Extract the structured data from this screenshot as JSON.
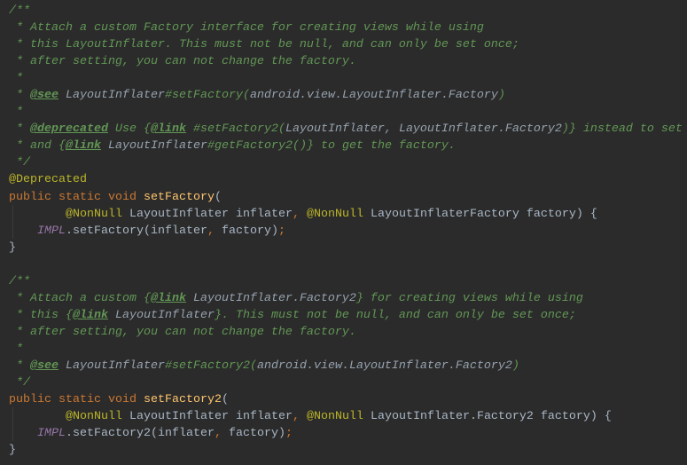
{
  "colors": {
    "background": "#2b2b2b",
    "comment": "#629755",
    "keyword": "#cc7832",
    "method": "#ffc66d",
    "annotation": "#bbb529",
    "field": "#9876aa",
    "text": "#a9b7c6"
  },
  "lines": [
    [
      [
        "/**",
        "c"
      ]
    ],
    [
      [
        " * Attach a custom Factory interface for creating views while using",
        "c"
      ]
    ],
    [
      [
        " * this LayoutInflater. This must not be null, and can only be set once;",
        "c"
      ]
    ],
    [
      [
        " * after setting, you can not change the factory.",
        "c"
      ]
    ],
    [
      [
        " *",
        "c"
      ]
    ],
    [
      [
        " * ",
        "c"
      ],
      [
        "@see",
        "tag"
      ],
      [
        " LayoutInflater",
        "ref"
      ],
      [
        "#setFactory(",
        "c"
      ],
      [
        "android.view.LayoutInflater.Factory",
        "ref"
      ],
      [
        ")",
        "c"
      ]
    ],
    [
      [
        " *",
        "c"
      ]
    ],
    [
      [
        " * ",
        "c"
      ],
      [
        "@deprecated",
        "tag"
      ],
      [
        " Use {",
        "c"
      ],
      [
        "@link",
        "tag"
      ],
      [
        " #setFactory2(",
        "c"
      ],
      [
        "LayoutInflater, LayoutInflater.Factory2",
        "ref"
      ],
      [
        ")} instead to set",
        "c"
      ]
    ],
    [
      [
        " * and {",
        "c"
      ],
      [
        "@link",
        "tag"
      ],
      [
        " LayoutInflater",
        "ref"
      ],
      [
        "#getFactory2()} to get the factory.",
        "c"
      ]
    ],
    [
      [
        " */",
        "c"
      ]
    ],
    [
      [
        "@Deprecated",
        "ann"
      ]
    ],
    [
      [
        "public static void ",
        "kw"
      ],
      [
        "setFactory",
        "fn"
      ],
      [
        "(",
        "t"
      ]
    ],
    [
      [
        "        ",
        "t"
      ],
      [
        "@NonNull",
        "ann"
      ],
      [
        " LayoutInflater inflater",
        "t"
      ],
      [
        ", ",
        "kw"
      ],
      [
        "@NonNull",
        "ann"
      ],
      [
        " LayoutInflaterFactory factory) {",
        "t"
      ]
    ],
    [
      [
        "    ",
        "t"
      ],
      [
        "IMPL",
        "fld"
      ],
      [
        ".setFactory(inflater",
        "t"
      ],
      [
        ", ",
        "kw"
      ],
      [
        "factory)",
        "t"
      ],
      [
        ";",
        "kw"
      ]
    ],
    [
      [
        "}",
        "t"
      ]
    ],
    [
      [
        "",
        "t"
      ]
    ],
    [
      [
        "/**",
        "c"
      ]
    ],
    [
      [
        " * Attach a custom {",
        "c"
      ],
      [
        "@link",
        "tag"
      ],
      [
        " LayoutInflater.Factory2",
        "ref"
      ],
      [
        "} for creating views while using",
        "c"
      ]
    ],
    [
      [
        " * this {",
        "c"
      ],
      [
        "@link",
        "tag"
      ],
      [
        " LayoutInflater",
        "ref"
      ],
      [
        "}. This must not be null, and can only be set once;",
        "c"
      ]
    ],
    [
      [
        " * after setting, you can not change the factory.",
        "c"
      ]
    ],
    [
      [
        " *",
        "c"
      ]
    ],
    [
      [
        " * ",
        "c"
      ],
      [
        "@see",
        "tag"
      ],
      [
        " LayoutInflater",
        "ref"
      ],
      [
        "#setFactory2(",
        "c"
      ],
      [
        "android.view.LayoutInflater.Factory2",
        "ref"
      ],
      [
        ")",
        "c"
      ]
    ],
    [
      [
        " */",
        "c"
      ]
    ],
    [
      [
        "public static void ",
        "kw"
      ],
      [
        "setFactory2",
        "fn"
      ],
      [
        "(",
        "t"
      ]
    ],
    [
      [
        "        ",
        "t"
      ],
      [
        "@NonNull",
        "ann"
      ],
      [
        " LayoutInflater inflater",
        "t"
      ],
      [
        ", ",
        "kw"
      ],
      [
        "@NonNull",
        "ann"
      ],
      [
        " LayoutInflater.Factory2 factory) {",
        "t"
      ]
    ],
    [
      [
        "    ",
        "t"
      ],
      [
        "IMPL",
        "fld"
      ],
      [
        ".setFactory2(inflater",
        "t"
      ],
      [
        ", ",
        "kw"
      ],
      [
        "factory)",
        "t"
      ],
      [
        ";",
        "kw"
      ]
    ],
    [
      [
        "}",
        "t"
      ]
    ]
  ]
}
